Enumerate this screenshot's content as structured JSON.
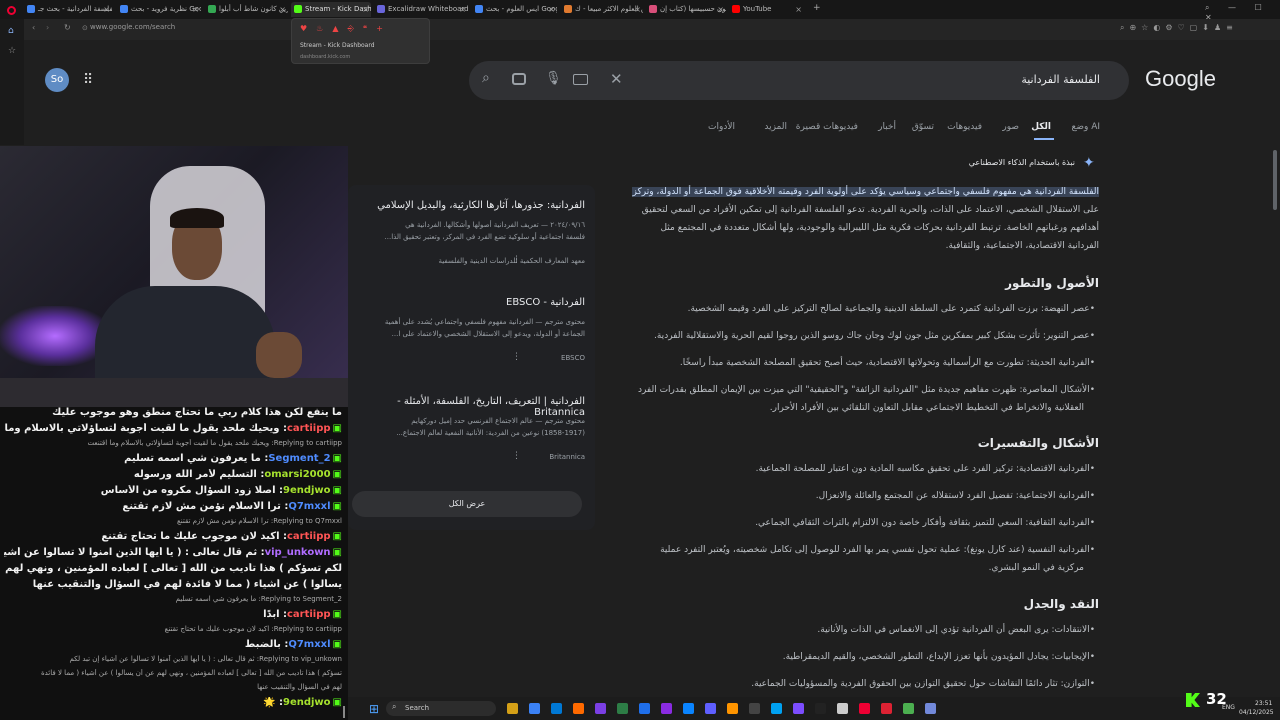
{
  "browser": {
    "tabs": [
      {
        "label": "الفلسفة الفردانية - بحث جـ",
        "color": "#4285f4"
      },
      {
        "label": "نظرية فرويد - بحث Google",
        "color": "#4285f4"
      },
      {
        "label": "تطرين كانون شاط أب أبلوا",
        "color": "#34a853"
      },
      {
        "label": "Stream - Kick Dashboard",
        "color": "#53fc18"
      },
      {
        "label": "Excalidraw Whiteboard",
        "color": "#6965db"
      },
      {
        "label": "ايس العلوم - بحث Google",
        "color": "#4285f4"
      },
      {
        "label": "ايس العلوم الاكثر مبيعا - ك",
        "color": "#e07a2f"
      },
      {
        "label": "يستعينون حسبيسها (كتاب إن",
        "color": "#d94f7a"
      },
      {
        "label": "YouTube",
        "color": "#ff0000"
      }
    ],
    "url": "www.google.com/search",
    "tab_popup": {
      "title": "Stream - Kick Dashboard",
      "domain": "dashboard.kick.com"
    }
  },
  "google": {
    "logo": "Google",
    "query": "الفلسفة الفردانية",
    "avatar": "So",
    "nav_tabs": [
      "وضع AI",
      "الكل",
      "صور",
      "فيديوهات",
      "تسوّق",
      "أخبار",
      "فيديوهات قصيرة",
      "المزيد",
      "الأدوات"
    ],
    "ai_label": "نبذة باستخدام الذكاء الاصطناعي",
    "intro_lines": [
      "الفلسفة الفردانية هي مفهوم فلسفي واجتماعي وسياسي يؤكد على أولوية الفرد وقيمته الأخلاقية فوق الجماعة أو الدولة، وتركز",
      "على الاستقلال الشخصي، الاعتماد على الذات، والحرية الفردية. تدعو الفلسفة الفردانية إلى تمكين الأفراد من السعي لتحقيق",
      "أهدافهم ورغباتهم الخاصة. ترتبط الفردانية بحركات فكرية مثل الليبرالية والوجودية، ولها أشكال متعددة في المجتمع مثل",
      "الفردانية الاقتصادية، الاجتماعية، والثقافية."
    ],
    "sections": [
      {
        "heading": "الأصول والتطور",
        "items": [
          "عصر النهضة: برزت الفردانية كتمرد على السلطة الدينية والجماعية لصالح التركيز على الفرد وقيمه الشخصية.",
          "عصر التنوير: تأثرت بشكل كبير بمفكرين مثل جون لوك وجان جاك روسو الذين روجوا لقيم الحرية والاستقلالية الفردية.",
          "الفردانية الحديثة: تطورت مع الرأسمالية وتحولاتها الاقتصادية، حيث أصبح تحقيق المصلحة الشخصية مبدأ راسخًا.",
          "الأشكال المعاصرة: ظهرت مفاهيم جديدة مثل \"الفردانية الزائفة\" و\"الحقيقية\" التي ميزت بين الإيمان المطلق بقدرات الفرد",
          "العقلانية والانخراط في التخطيط الاجتماعي مقابل التعاون التلقائي بين الأفراد الأحرار."
        ]
      },
      {
        "heading": "الأشكال والتفسيرات",
        "items": [
          "الفردانية الاقتصادية: تركيز الفرد على تحقيق مكاسبه المادية دون اعتبار للمصلحة الجماعية.",
          "الفردانية الاجتماعية: تفضيل الفرد لاستقلاله عن المجتمع والعائلة والانعزال.",
          "الفردانية الثقافية: السعي للتميز بثقافة وأفكار خاصة دون الالتزام بالتراث الثقافي الجماعي.",
          "الفردانية النفسية (عند كارل يونغ): عملية تحول نفسي يمر بها الفرد للوصول إلى تكامل شخصيته، ويُعتبر التفرد عملية",
          "مركزية في النمو البشري."
        ]
      },
      {
        "heading": "النقد والجدل",
        "items": [
          "الانتقادات: يرى البعض أن الفردانية تؤدي إلى الانغماس في الذات والأنانية.",
          "الإيجابيات: يجادل المؤيدون بأنها تعزز الإبداع، التطور الشخصي، والقيم الديمقراطية.",
          "التوازن: تثار دائمًا النقاشات حول تحقيق التوازن بين الحقوق الفردية والمسؤوليات الجماعية."
        ]
      }
    ],
    "side_results": [
      {
        "title": "الفردانية: جذورها، آثارها الكارثية، والبديل الإسلامي",
        "snip1": "٢٠٢٤/٠٩/١٦ — تعريف الفردانية أصولها وأشكالها. الفردانية هي",
        "snip2": "فلسفة اجتماعية أو سلوكية تضع الفرد في المركز، وتعتبر تحقيق الذا...",
        "source": "معهد المعارف الحكمية للدراسات الدينية والفلسفية"
      },
      {
        "title": "الفردانية - EBSCO",
        "snip1": "محتوى مترجم — الفردانية مفهوم فلسفي واجتماعي يُشدد على أهمية",
        "snip2": "الجماعة أو الدولة، ويدعو إلى الاستقلال الشخصي والاعتماد على ا...",
        "source": "EBSCO"
      },
      {
        "title": "الفردانية | التعريف، التاريخ، الفلسفة، الأمثلة - Britannica",
        "snip1": "محتوى مترجم — عالم الاجتماع الفرنسي حدد إميل دوركهايم",
        "snip2": "(1858-1917) نوعين من الفردية: الأنانية النفعية لعالم الاجتماع...",
        "source": "Britannica"
      }
    ],
    "show_all": "عرض الكل"
  },
  "chat": [
    {
      "type": "msg",
      "user": "",
      "text": "ما ينفع لكن هذا كلام ربي ما تحتاج منطق وهو موجوب عليك"
    },
    {
      "type": "msg",
      "user": "cartiipp",
      "user_color": "#ff5555",
      "text": "ويحيك ملحد يقول ما لقيت أجوبة لتساؤلاتي بالاسلام وما اقتنعت"
    },
    {
      "type": "reply",
      "text": "Replying to cartiipp: ويحيك ملحد يقول ما لقيت أجوبة لتساؤلاتي بالاسلام وما اقتنعت"
    },
    {
      "type": "msg",
      "user": "Segment_2",
      "user_color": "#4f8cff",
      "text": "ما يعرفون شي اسمه تسليم"
    },
    {
      "type": "msg",
      "user": "omarsi2000",
      "user_color": "#a6e22e",
      "text": "التسليم لأمر الله ورسوله"
    },
    {
      "type": "msg",
      "user": "9endjwo",
      "user_color": "#a6e22e",
      "text": "اصلًا زود السؤال مكروه من الأساس"
    },
    {
      "type": "msg",
      "user": "Q7mxxl",
      "user_color": "#4f8cff",
      "text": "ترا الاسلام نؤمن مش لازم تقتنع"
    },
    {
      "type": "reply",
      "text": "Replying to Q7mxxl: ترا الاسلام نؤمن مش لازم تقتنع"
    },
    {
      "type": "msg",
      "user": "cartiipp",
      "user_color": "#ff5555",
      "text": "اكيد لان موجوب عليك ما تحتاج تقتنع"
    },
    {
      "type": "msg",
      "user": "vip_unkown",
      "user_color": "#b06cff",
      "text": "ثم قال تعالى : ( يا أيها الذين آمنوا لا تسألوا عن أشياء إن تبد"
    },
    {
      "type": "cont",
      "text": "لكم تسؤكم ) هذا تأديب من الله [ تعالى ] لعباده المؤمنين ، ونهي لهم عن أن"
    },
    {
      "type": "cont",
      "text": "يسألوا ) عن أشياء ( مما لا فائدة لهم في السؤال والتنقيب عنها"
    },
    {
      "type": "reply",
      "text": "Replying to Segment_2: ما يعرفون شي اسمه تسليم"
    },
    {
      "type": "msg",
      "user": "cartiipp",
      "user_color": "#ff5555",
      "text": "ابدًا"
    },
    {
      "type": "reply",
      "text": "Replying to cartiipp: اكيد لان موجوب عليك ما تحتاج تقتنع"
    },
    {
      "type": "msg",
      "user": "Q7mxxl",
      "user_color": "#4f8cff",
      "text": "بالضبط"
    },
    {
      "type": "reply",
      "text": "Replying to vip_unkown: ثم قال تعالى : ( يا أيها الذين آمنوا لا تسألوا عن أشياء إن تبد لكم"
    },
    {
      "type": "reply",
      "text": "تسؤكم ) هذا تأديب من الله [ تعالى ] لعباده المؤمنين ، ونهي لهم عن أن يسألوا ) عن أشياء ( مما لا فائدة"
    },
    {
      "type": "reply",
      "text": "لهم في السؤال والتنقيب عنها"
    },
    {
      "type": "msg",
      "user": "9endjwo",
      "user_color": "#a6e22e",
      "text": "🌟"
    }
  ],
  "taskbar": {
    "search": "Search",
    "time": "23:51",
    "date": "04/12/2025",
    "lang": "ENG",
    "viewers": "32"
  }
}
